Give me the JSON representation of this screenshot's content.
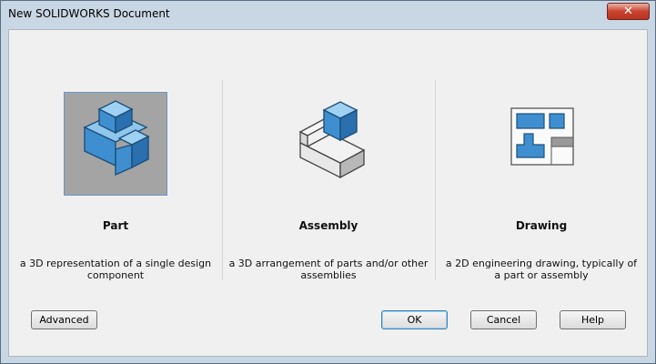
{
  "window": {
    "title": "New SOLIDWORKS Document",
    "close_glyph": "✕"
  },
  "options": [
    {
      "label": "Part",
      "description": "a 3D representation of a single design component",
      "icon": "part-icon",
      "selected": true
    },
    {
      "label": "Assembly",
      "description": "a 3D arrangement of parts and/or other assemblies",
      "icon": "assembly-icon",
      "selected": false
    },
    {
      "label": "Drawing",
      "description": "a 2D engineering drawing, typically of a part or assembly",
      "icon": "drawing-icon",
      "selected": false
    }
  ],
  "buttons": {
    "advanced": "Advanced",
    "ok": "OK",
    "cancel": "Cancel",
    "help": "Help"
  },
  "colors": {
    "accent_blue": "#3f8fd0",
    "selection_gray": "#a4a4a4",
    "title_bg": "#c9d6e4"
  }
}
